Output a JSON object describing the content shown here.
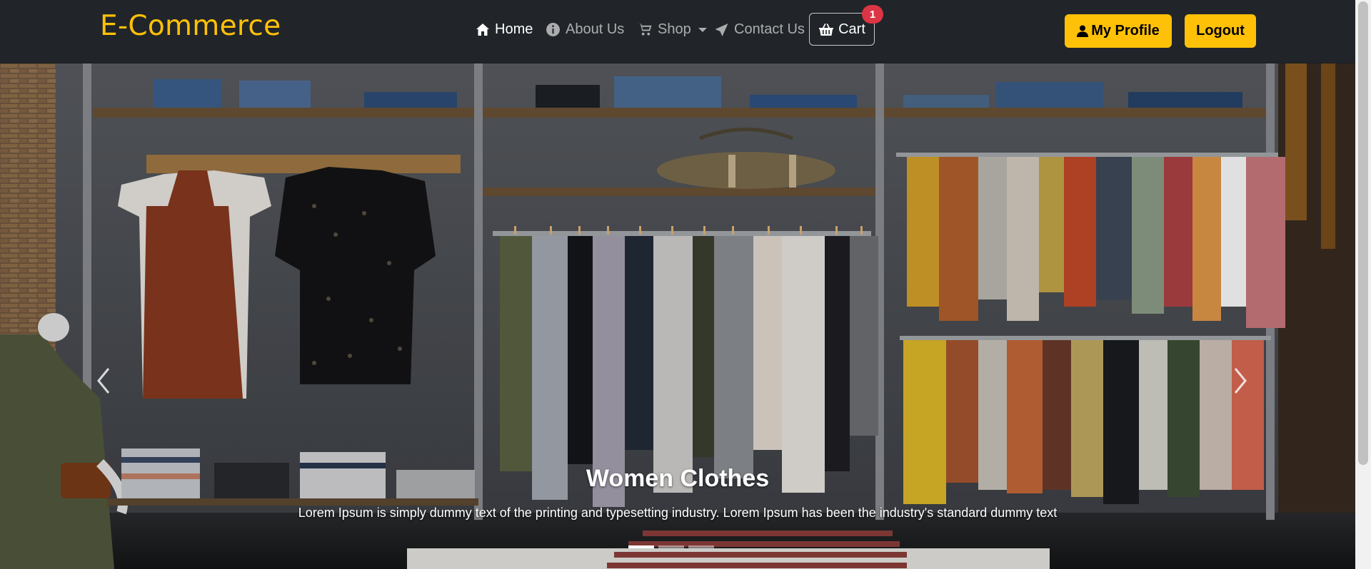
{
  "brand": {
    "name": "E-Commerce",
    "color": "#ffc107"
  },
  "nav": {
    "items": [
      {
        "label": "Home",
        "icon": "home-icon",
        "active": true
      },
      {
        "label": "About Us",
        "icon": "info-icon",
        "active": false
      },
      {
        "label": "Shop",
        "icon": "cart-icon",
        "dropdown": true,
        "active": false
      },
      {
        "label": "Contact Us",
        "icon": "paper-plane-icon",
        "active": false
      }
    ],
    "cart": {
      "label": "Cart",
      "icon": "basket-icon",
      "badge": "1"
    }
  },
  "actions": {
    "profile_label": "My Profile",
    "logout_label": "Logout"
  },
  "carousel": {
    "title": "Women Clothes",
    "text": "Lorem Ipsum is simply dummy text of the printing and typesetting industry. Lorem Ipsum has been the industry's standard dummy text",
    "slides": 3,
    "active_slide": 1
  },
  "colors": {
    "navbar": "#212529",
    "accent": "#ffc107",
    "badge": "#dc3545"
  }
}
